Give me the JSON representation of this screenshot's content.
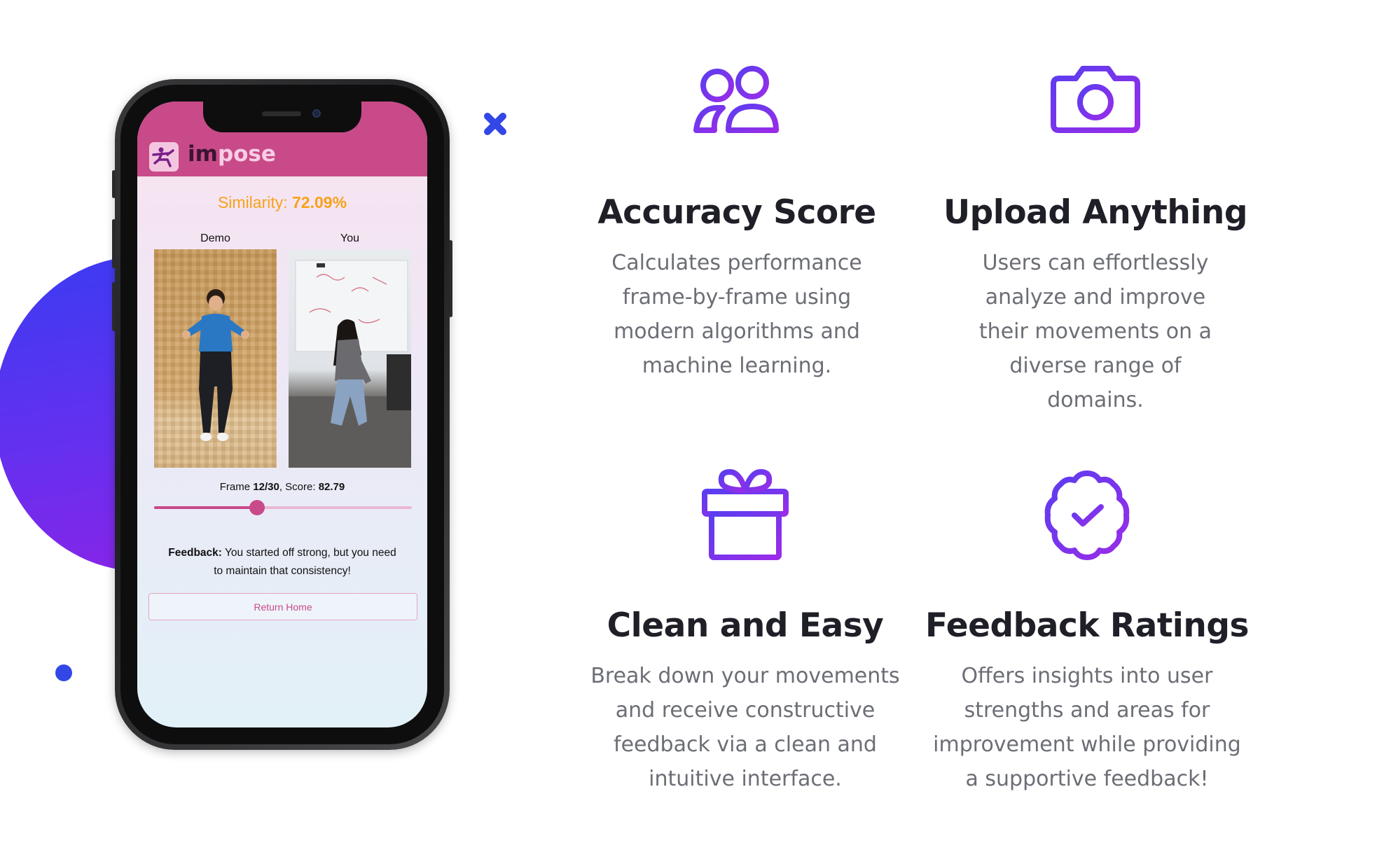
{
  "phone": {
    "app_name_prefix": "im",
    "app_name_suffix": "pose",
    "similarity_label": "Similarity:",
    "similarity_value": "72.09%",
    "demo_label": "Demo",
    "you_label": "You",
    "frame_label": "Frame",
    "frame_value": "12/30",
    "score_label": ", Score:",
    "score_value": "82.79",
    "slider_fraction": 0.4,
    "feedback_label": "Feedback:",
    "feedback_text": " You started off strong, but you need to maintain that consistency!",
    "return_button": "Return Home"
  },
  "features": [
    {
      "icon": "users-icon",
      "title": "Accuracy Score",
      "description": "Calculates performance frame-by-frame using modern algorithms and machine learning."
    },
    {
      "icon": "camera-icon",
      "title": "Upload Anything",
      "description": "Users can effortlessly analyze and improve their movements on a diverse range of domains."
    },
    {
      "icon": "gift-icon",
      "title": "Clean and Easy",
      "description": "Break down your movements and receive constructive feedback via a clean and intuitive interface."
    },
    {
      "icon": "badge-check-icon",
      "title": "Feedback Ratings",
      "description": "Offers insights into user strengths and areas for improvement while providing a supportive feedback!"
    }
  ],
  "colors": {
    "accent_purple": "#7b2ff0",
    "app_pink": "#c84a89",
    "similarity_orange": "#f7a21b",
    "heading": "#1f1f28",
    "body_text": "#6c6e76"
  }
}
